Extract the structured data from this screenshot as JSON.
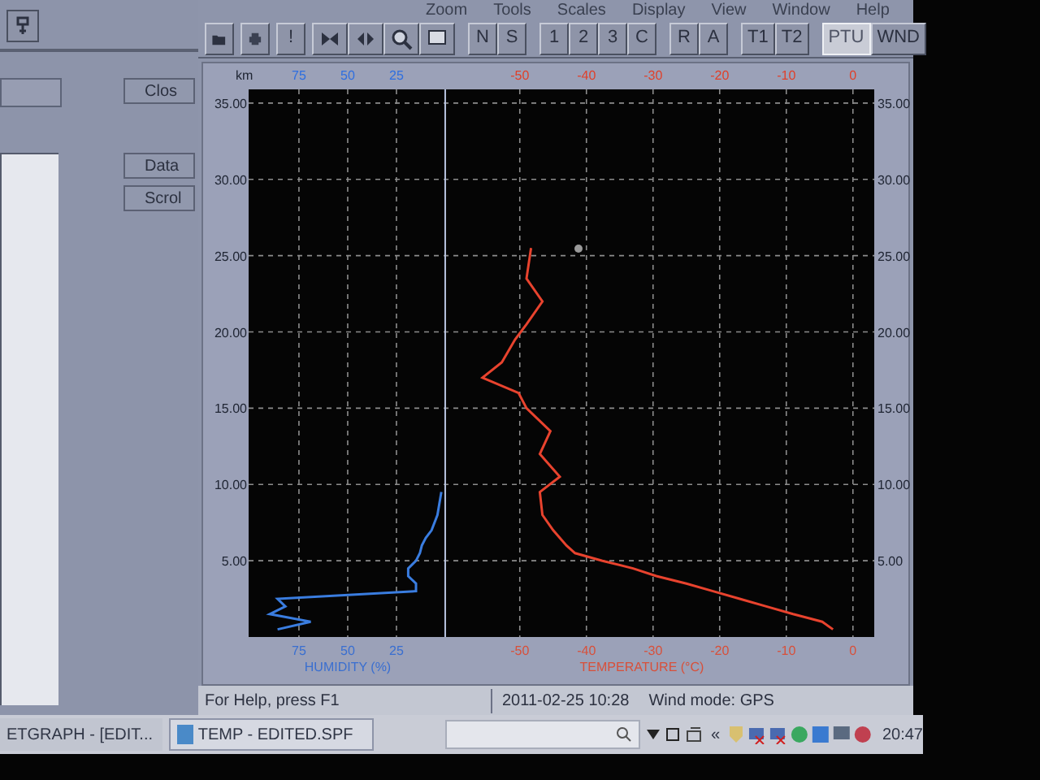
{
  "left_pane": {
    "buttons": [
      "Clos",
      "Data",
      "Scrol"
    ]
  },
  "menu": [
    "Zoom",
    "Tools",
    "Scales",
    "Display",
    "View",
    "Window",
    "Help"
  ],
  "toolbar": {
    "exclaim": "!",
    "groups": [
      [
        {
          "label": "N",
          "selected": false
        },
        {
          "label": "S",
          "selected": false
        }
      ],
      [
        {
          "label": "1",
          "selected": false
        },
        {
          "label": "2",
          "selected": false
        },
        {
          "label": "3",
          "selected": false
        },
        {
          "label": "C",
          "selected": false
        }
      ],
      [
        {
          "label": "R",
          "selected": false
        },
        {
          "label": "A",
          "selected": false
        }
      ],
      [
        {
          "label": "T1",
          "selected": false
        },
        {
          "label": "T2",
          "selected": false
        }
      ],
      [
        {
          "label": "PTU",
          "selected": true
        },
        {
          "label": "WND",
          "selected": false
        }
      ]
    ]
  },
  "chart": {
    "unit_label": "km",
    "top_humidity_ticks": [
      "75",
      "50",
      "25"
    ],
    "top_temperature_ticks": [
      "-50",
      "-40",
      "-30",
      "-20",
      "-10",
      "0"
    ],
    "right_altitude_ticks": [
      "35.00",
      "30.00",
      "25.00",
      "20.00",
      "15.00",
      "10.00",
      "5.00"
    ],
    "temperature": {
      "chart_data": {
        "type": "line",
        "orientation": "horizontal",
        "xlabel": "TEMPERATURE (°C)",
        "x": [
          0.5,
          1,
          1.5,
          2,
          2.5,
          3,
          3.5,
          4,
          4.5,
          5,
          5.5,
          6,
          6.5,
          7,
          8,
          9.5,
          10.5,
          12,
          13.5,
          15,
          16,
          17,
          18,
          19.5,
          20.5,
          22,
          23.5,
          25.5
        ],
        "series": [
          {
            "color": "#e8432e",
            "values": [
              -3,
              -4.6,
              -9,
              -13,
              -17,
              -21,
              -25,
              -29.5,
              -33,
              -37.6,
              -41.7,
              -43,
              -44,
              -45,
              -46.6,
              -47,
              -44,
              -47,
              -45.4,
              -49,
              -50.2,
              -55.6,
              -52.7,
              -50.7,
              -49,
              -46.6,
              -49,
              -48.3
            ]
          }
        ],
        "xlim": [
          -90.7,
          3.2
        ],
        "ylim": [
          0,
          35.9
        ],
        "grid": true,
        "xticks": [
          -50,
          -40,
          -30,
          -20,
          -10,
          0
        ],
        "yticks": [
          {
            "value": 5,
            "label": "5.00"
          },
          {
            "value": 10,
            "label": "10.00"
          },
          {
            "value": 15,
            "label": "15.00"
          },
          {
            "value": 20,
            "label": "20.00"
          },
          {
            "value": 25,
            "label": "25.00"
          },
          {
            "value": 30,
            "label": "30.00"
          },
          {
            "value": 35,
            "label": "35.00"
          }
        ]
      }
    },
    "humidity": {
      "chart_data": {
        "type": "line",
        "orientation": "horizontal",
        "xlabel": "HUMIDITY (%)",
        "x": [
          0.5,
          1,
          1.5,
          2,
          2.5,
          3,
          3.5,
          4,
          4.5,
          5,
          5.5,
          6,
          6.5,
          7,
          8,
          9.5
        ],
        "series": [
          {
            "color": "#3a7de0",
            "values": [
              86,
              69,
              90,
              82,
              86,
              15,
              15,
              19,
              19,
              15,
              13,
              12,
              10,
              7,
              4,
              2
            ]
          }
        ],
        "xlim": [
          100.8,
          -220
        ],
        "ylim": [
          0,
          35.9
        ],
        "xticks": [
          75,
          50,
          25
        ]
      }
    }
  },
  "status_bar": {
    "help": "For Help, press F1",
    "datetime": "2011-02-25 10:28",
    "wind_mode": "Wind mode: GPS"
  },
  "taskbar": {
    "tasks": [
      {
        "label": "ETGRAPH - [EDIT...",
        "selected": false
      },
      {
        "label": "TEMP - EDITED.SPF",
        "selected": true
      }
    ],
    "chevron": "«",
    "clock": "20:47"
  }
}
